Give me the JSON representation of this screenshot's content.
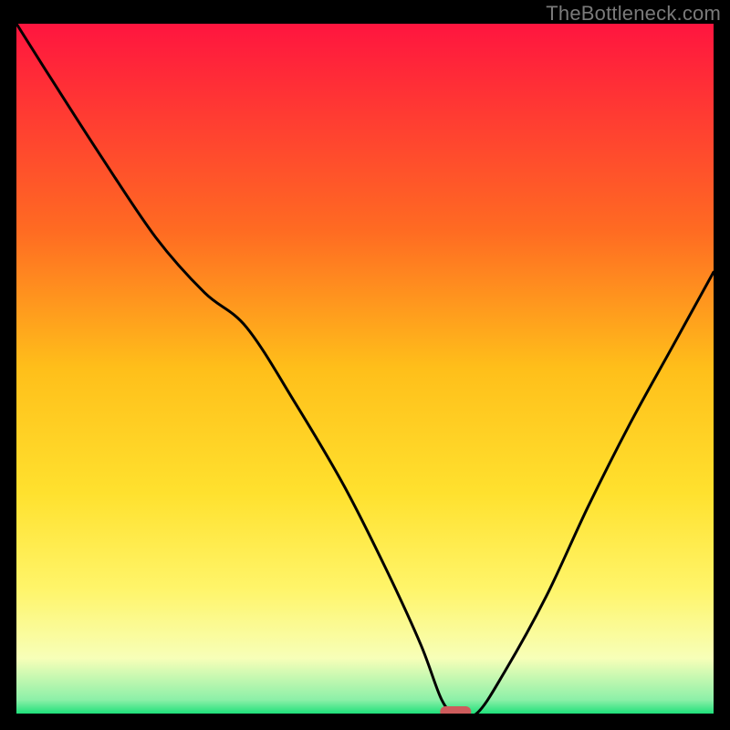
{
  "watermark": "TheBottleneck.com",
  "chart_data": {
    "type": "line",
    "title": "",
    "xlabel": "",
    "ylabel": "",
    "xlim": [
      0,
      100
    ],
    "ylim": [
      0,
      100
    ],
    "grid": false,
    "legend": false,
    "optimum_marker": {
      "x": 63,
      "y": 0
    },
    "background_gradient": [
      {
        "y": 100,
        "color": "#ff153f"
      },
      {
        "y": 70,
        "color": "#ff6b22"
      },
      {
        "y": 50,
        "color": "#ffbf1a"
      },
      {
        "y": 32,
        "color": "#ffe12e"
      },
      {
        "y": 18,
        "color": "#fff56a"
      },
      {
        "y": 8,
        "color": "#f7ffb8"
      },
      {
        "y": 2,
        "color": "#8cf0a8"
      },
      {
        "y": 0,
        "color": "#1fe07a"
      }
    ],
    "series": [
      {
        "name": "bottleneck-curve",
        "x": [
          0,
          5,
          12,
          20,
          27,
          33,
          40,
          47,
          53,
          58,
          61,
          63,
          66,
          70,
          76,
          82,
          88,
          94,
          100
        ],
        "y": [
          100,
          92,
          81,
          69,
          61,
          56,
          45,
          33,
          21,
          10,
          2,
          0,
          0,
          6,
          17,
          30,
          42,
          53,
          64
        ]
      }
    ]
  }
}
